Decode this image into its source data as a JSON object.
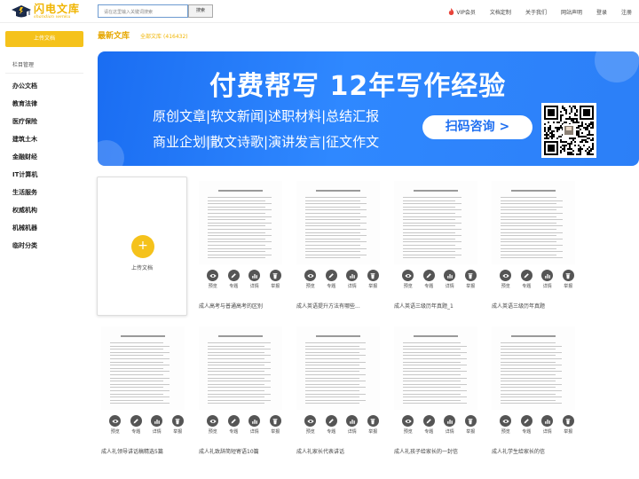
{
  "header": {
    "logo_cn": "闪电文库",
    "logo_en": "shandian wenku",
    "search_placeholder": "请在这里输入关键词搜索",
    "search_button": "搜索",
    "nav": [
      "VIP会员",
      "文档定制",
      "关于我们",
      "网站声明",
      "登录",
      "注册"
    ]
  },
  "sidebar": {
    "upload_label": "上传文档",
    "section_title": "栏目管理",
    "categories": [
      "办公文档",
      "教育法律",
      "医疗保险",
      "建筑土木",
      "金融财经",
      "IT计算机",
      "生活服务",
      "权威机构",
      "机械机器",
      "临时分类"
    ]
  },
  "main": {
    "latest_label": "最新文库",
    "all_docs_label": "全部文库",
    "all_docs_count": "(416432)"
  },
  "banner": {
    "title": "付费帮写 12年写作经验",
    "line1": "原创文章|软文新闻|述职材料|总结汇报",
    "line2": "商业企划|散文诗歌|演讲发言|征文作文",
    "cta": "扫码咨询 >"
  },
  "upload_card": {
    "label": "上传文档"
  },
  "actions": [
    "预览",
    "专题",
    "详情",
    "举报"
  ],
  "documents": [
    "成人高考与普通高考的区别",
    "成人英语提升方法有哪些...",
    "成人英语三级历年真题_1",
    "成人英语三级历年真题",
    "成人礼领导讲话稿精选5篇",
    "成人礼致辞简短寄语10篇",
    "成人礼家长代表讲话",
    "成人礼孩子给家长的一封信",
    "成人礼学生给家长的信"
  ],
  "colors": {
    "accent": "#f5c21b",
    "banner_blue": "#1f6ff0",
    "action_icon": "#555555"
  }
}
